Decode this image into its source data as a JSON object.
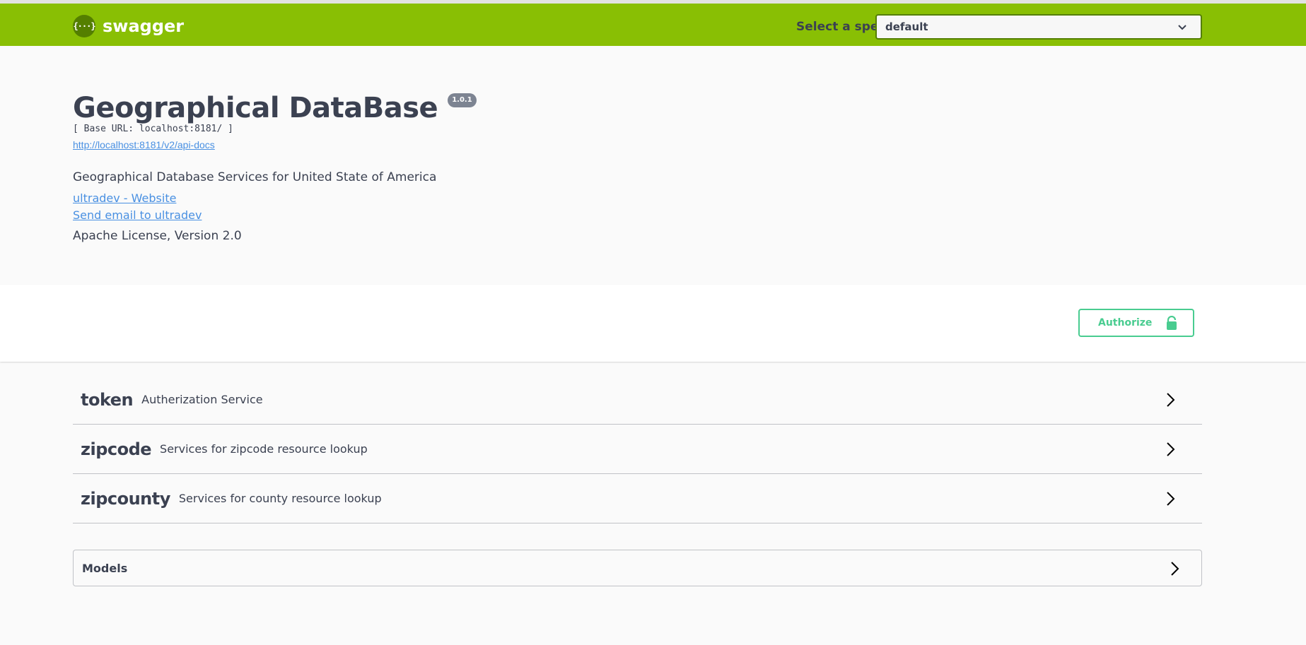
{
  "topbar": {
    "logo_icon_text": "{···}",
    "logo_text": "swagger",
    "select_spec_label": "Select a spec",
    "spec_selected": "default"
  },
  "info": {
    "title": "Geographical DataBase",
    "version": "1.0.1",
    "base_url": "[ Base URL: localhost:8181/ ]",
    "api_docs_link": "http://localhost:8181/v2/api-docs",
    "description": "Geographical Database Services for United State of America",
    "website_link": "ultradev - Website",
    "email_link": "Send email to ultradev",
    "license": "Apache License, Version 2.0"
  },
  "authorize": {
    "label": "Authorize",
    "icon": "lock-icon",
    "color": "#49cc90"
  },
  "tags": [
    {
      "name": "token",
      "description": "Autherization Service"
    },
    {
      "name": "zipcode",
      "description": "Services for zipcode resource lookup"
    },
    {
      "name": "zipcounty",
      "description": "Services for county resource lookup"
    }
  ],
  "models": {
    "title": "Models"
  },
  "colors": {
    "topbar": "#89bf04",
    "logo_dark": "#547f00",
    "link": "#4990e2",
    "text": "#3b4151",
    "version_badge": "#7d8492"
  }
}
